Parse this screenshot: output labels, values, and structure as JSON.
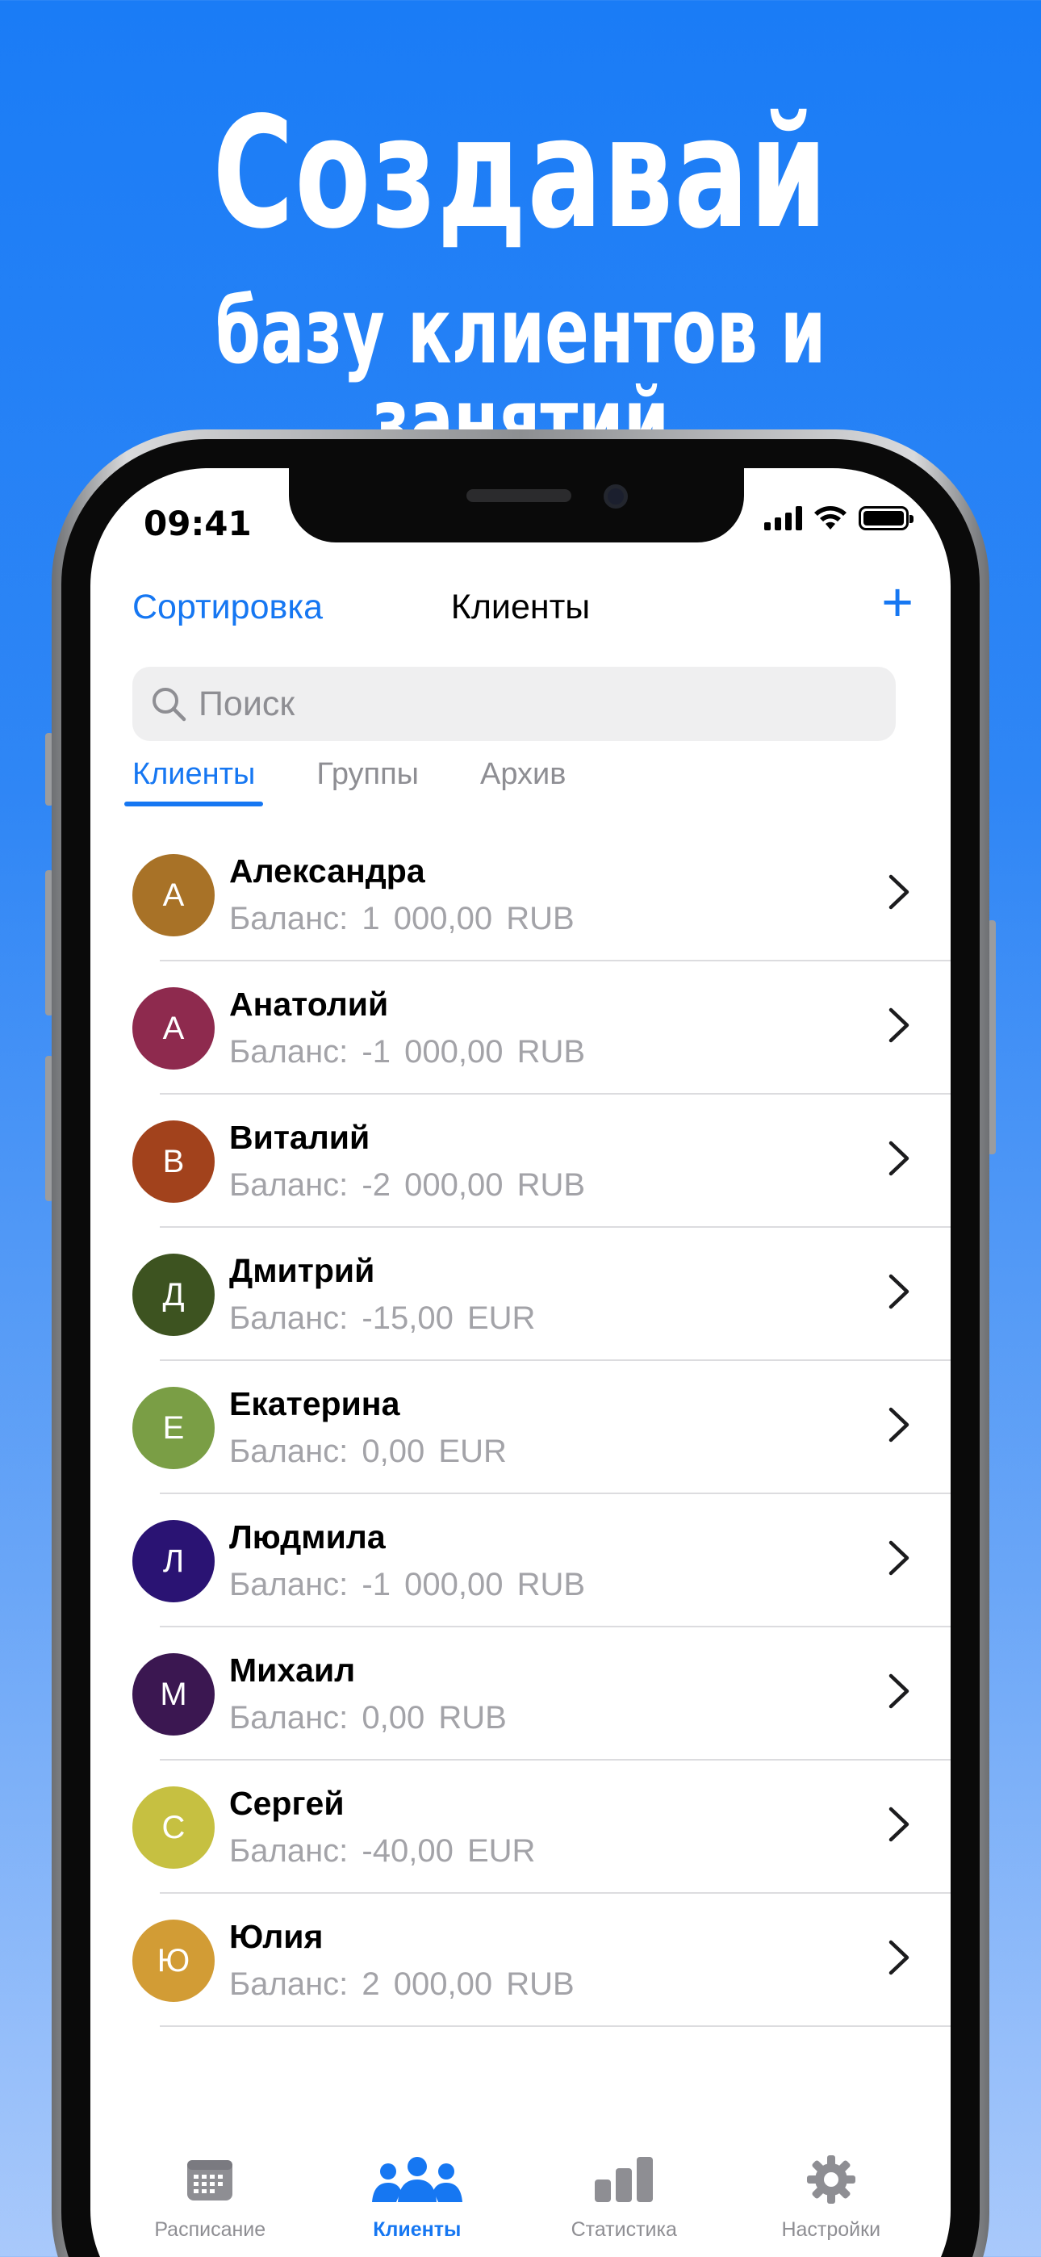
{
  "promo": {
    "headline": "Создавай",
    "subheadline": "базу клиентов и занятий"
  },
  "status_bar": {
    "time": "09:41"
  },
  "nav": {
    "left_label": "Сортировка",
    "title": "Клиенты",
    "add_label": "+"
  },
  "search": {
    "placeholder": "Поиск"
  },
  "segments": [
    "Клиенты",
    "Группы",
    "Архив"
  ],
  "balance_label": "Баланс:",
  "clients": [
    {
      "initial": "А",
      "name": "Александра",
      "amount": "1 000,00",
      "currency": "RUB",
      "color": "#a87227"
    },
    {
      "initial": "А",
      "name": "Анатолий",
      "amount": "-1 000,00",
      "currency": "RUB",
      "color": "#8e2a4e"
    },
    {
      "initial": "В",
      "name": "Виталий",
      "amount": "-2 000,00",
      "currency": "RUB",
      "color": "#a2421c"
    },
    {
      "initial": "Д",
      "name": "Дмитрий",
      "amount": "-15,00",
      "currency": "EUR",
      "color": "#3d5320"
    },
    {
      "initial": "Е",
      "name": "Екатерина",
      "amount": "0,00",
      "currency": "EUR",
      "color": "#7a9e45"
    },
    {
      "initial": "Л",
      "name": "Людмила",
      "amount": "-1 000,00",
      "currency": "RUB",
      "color": "#2a1373"
    },
    {
      "initial": "М",
      "name": "Михаил",
      "amount": "0,00",
      "currency": "RUB",
      "color": "#3b1751"
    },
    {
      "initial": "С",
      "name": "Сергей",
      "amount": "-40,00",
      "currency": "EUR",
      "color": "#c6c041"
    },
    {
      "initial": "Ю",
      "name": "Юлия",
      "amount": "2 000,00",
      "currency": "RUB",
      "color": "#d29c35"
    }
  ],
  "tabs": [
    {
      "label": "Расписание",
      "icon": "calendar-icon"
    },
    {
      "label": "Клиенты",
      "icon": "people-icon"
    },
    {
      "label": "Статистика",
      "icon": "chart-icon"
    },
    {
      "label": "Настройки",
      "icon": "gear-icon"
    }
  ],
  "colors": {
    "accent": "#1677f2",
    "inactive": "#8e8e93",
    "balance": "#a3a3a8"
  }
}
